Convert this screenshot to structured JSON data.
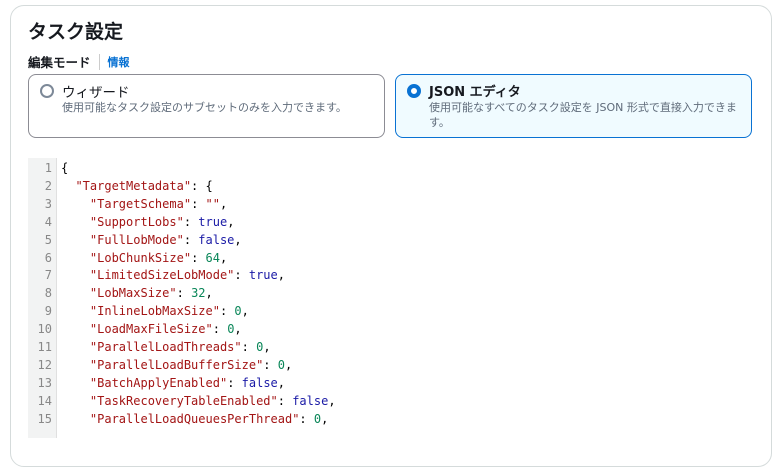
{
  "title": "タスク設定",
  "edit_mode": {
    "label": "編集モード",
    "info_link": "情報"
  },
  "options": [
    {
      "title": "ウィザード",
      "desc": "使用可能なタスク設定のサブセットのみを入力できます。",
      "selected": false
    },
    {
      "title": "JSON エディタ",
      "desc": "使用可能なすべてのタスク設定を JSON 形式で直接入力できます。",
      "selected": true
    }
  ],
  "editor": {
    "lines": [
      {
        "n": "1",
        "indent": "",
        "key": "",
        "sep": "{",
        "val": "",
        "vt": ""
      },
      {
        "n": "2",
        "indent": "  ",
        "key": "\"TargetMetadata\"",
        "sep": ": {",
        "val": "",
        "vt": ""
      },
      {
        "n": "3",
        "indent": "    ",
        "key": "\"TargetSchema\"",
        "sep": ": ",
        "val": "\"\"",
        "vt": "k",
        "end": ","
      },
      {
        "n": "4",
        "indent": "    ",
        "key": "\"SupportLobs\"",
        "sep": ": ",
        "val": "true",
        "vt": "b",
        "end": ","
      },
      {
        "n": "5",
        "indent": "    ",
        "key": "\"FullLobMode\"",
        "sep": ": ",
        "val": "false",
        "vt": "b",
        "end": ","
      },
      {
        "n": "6",
        "indent": "    ",
        "key": "\"LobChunkSize\"",
        "sep": ": ",
        "val": "64",
        "vt": "n",
        "end": ","
      },
      {
        "n": "7",
        "indent": "    ",
        "key": "\"LimitedSizeLobMode\"",
        "sep": ": ",
        "val": "true",
        "vt": "b",
        "end": ","
      },
      {
        "n": "8",
        "indent": "    ",
        "key": "\"LobMaxSize\"",
        "sep": ": ",
        "val": "32",
        "vt": "n",
        "end": ","
      },
      {
        "n": "9",
        "indent": "    ",
        "key": "\"InlineLobMaxSize\"",
        "sep": ": ",
        "val": "0",
        "vt": "n",
        "end": ","
      },
      {
        "n": "10",
        "indent": "    ",
        "key": "\"LoadMaxFileSize\"",
        "sep": ": ",
        "val": "0",
        "vt": "n",
        "end": ","
      },
      {
        "n": "11",
        "indent": "    ",
        "key": "\"ParallelLoadThreads\"",
        "sep": ": ",
        "val": "0",
        "vt": "n",
        "end": ","
      },
      {
        "n": "12",
        "indent": "    ",
        "key": "\"ParallelLoadBufferSize\"",
        "sep": ": ",
        "val": "0",
        "vt": "n",
        "end": ","
      },
      {
        "n": "13",
        "indent": "    ",
        "key": "\"BatchApplyEnabled\"",
        "sep": ": ",
        "val": "false",
        "vt": "b",
        "end": ","
      },
      {
        "n": "14",
        "indent": "    ",
        "key": "\"TaskRecoveryTableEnabled\"",
        "sep": ": ",
        "val": "false",
        "vt": "b",
        "end": ","
      },
      {
        "n": "15",
        "indent": "    ",
        "key": "\"ParallelLoadQueuesPerThread\"",
        "sep": ": ",
        "val": "0",
        "vt": "n",
        "end": ","
      }
    ]
  }
}
